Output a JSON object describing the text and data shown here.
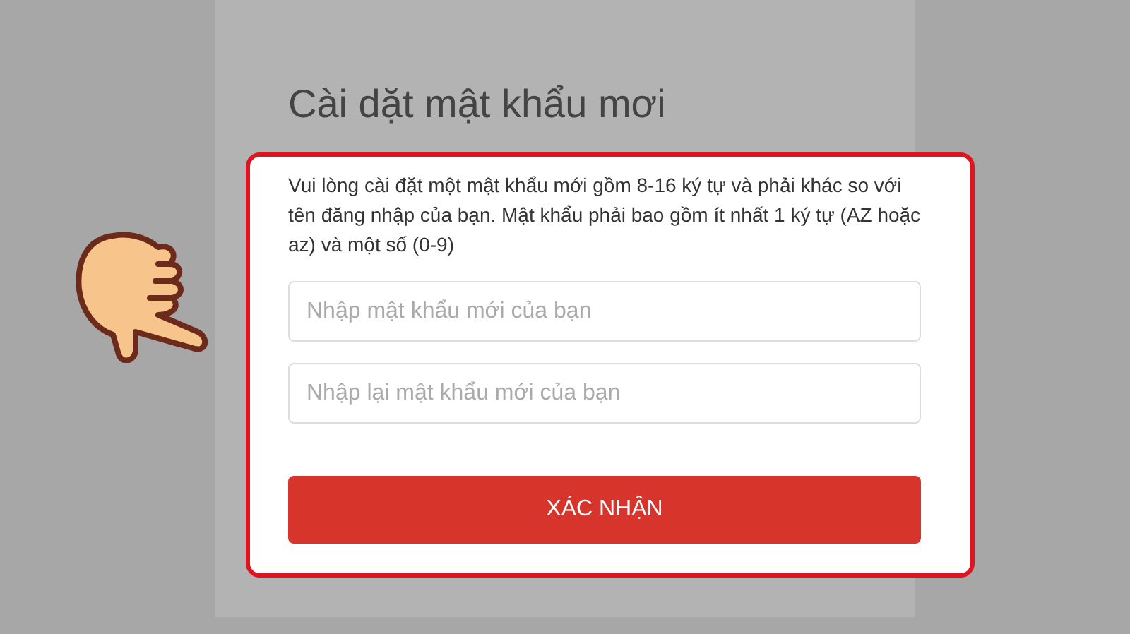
{
  "title": "Cài dặt mật khẩu mơi",
  "instructions": "Vui lòng cài đặt một mật khẩu mới gồm 8-16 ký tự và phải khác so với tên đăng nhập của bạn. Mật khẩu phải bao gồm ít nhất 1 ký tự (AZ hoặc az) và một số (0-9)",
  "fields": [
    {
      "placeholder": "Nhập mật khẩu mới của bạn"
    },
    {
      "placeholder": "Nhập lại mật khẩu mới của bạn"
    }
  ],
  "confirm_button": "XÁC NHẬN"
}
